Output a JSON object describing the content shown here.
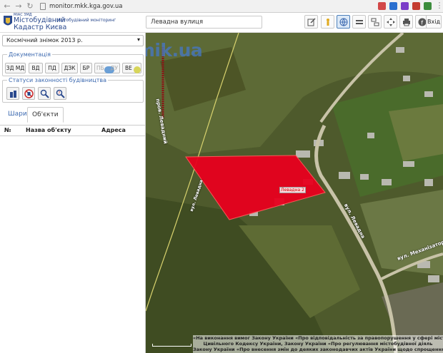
{
  "browser": {
    "url": "monitor.mkk.kga.gov.ua"
  },
  "header": {
    "brand_small": "МІАС ЗМД",
    "brand_line1": "Містобудівний",
    "brand_line2": "Кадастр Києва",
    "brand_sub": "Містобудівний моніторинг",
    "search_value": "Левадна вулиця",
    "login_label": "Вхід",
    "toolbar_icons": [
      "edit-icon",
      "person-icon",
      "globe-icon",
      "layers-icon",
      "split-icon",
      "move-icon",
      "print-icon",
      "facebook-icon"
    ]
  },
  "panel": {
    "basemap_select": "Космічний знімок 2013 р.",
    "docs_legend": "Документація",
    "doc_buttons": [
      "ЗД МД",
      "ВД",
      "ПД",
      "ДЗК",
      "БР",
      "ПБ",
      "ДУ",
      "ВЕ"
    ],
    "status_legend": "Статуси законності будівництва",
    "status_icons": [
      "building-icon",
      "no-build-icon",
      "search-icon",
      "question-icon"
    ],
    "tabs": [
      "Шари",
      "Об'єкти"
    ],
    "table_headers": [
      "№",
      "Назва об'єкту",
      "Адреса"
    ]
  },
  "map": {
    "watermark": "Forum.Domik.ua",
    "parcel_label": "Левадна 2",
    "streets": [
      "вул. Левадна",
      "вул. Левадна",
      "вул. Механізаторів",
      "пров. Левадний"
    ],
    "notice_line1": "«На виконання вимог Закону України «Про відповідальність за правопорушення у сфері містобу",
    "notice_line2": "Цивільного Кодексу України, Закону України «Про регулювання містобудівної діяль",
    "notice_line3": "Закону України «Про внесення змін до деяких законодавчих актів України щодо спрощення умов веден"
  },
  "colors": {
    "brand": "#2b4a8e",
    "accent": "#3d6ab0",
    "parcel": "#e8001e"
  }
}
